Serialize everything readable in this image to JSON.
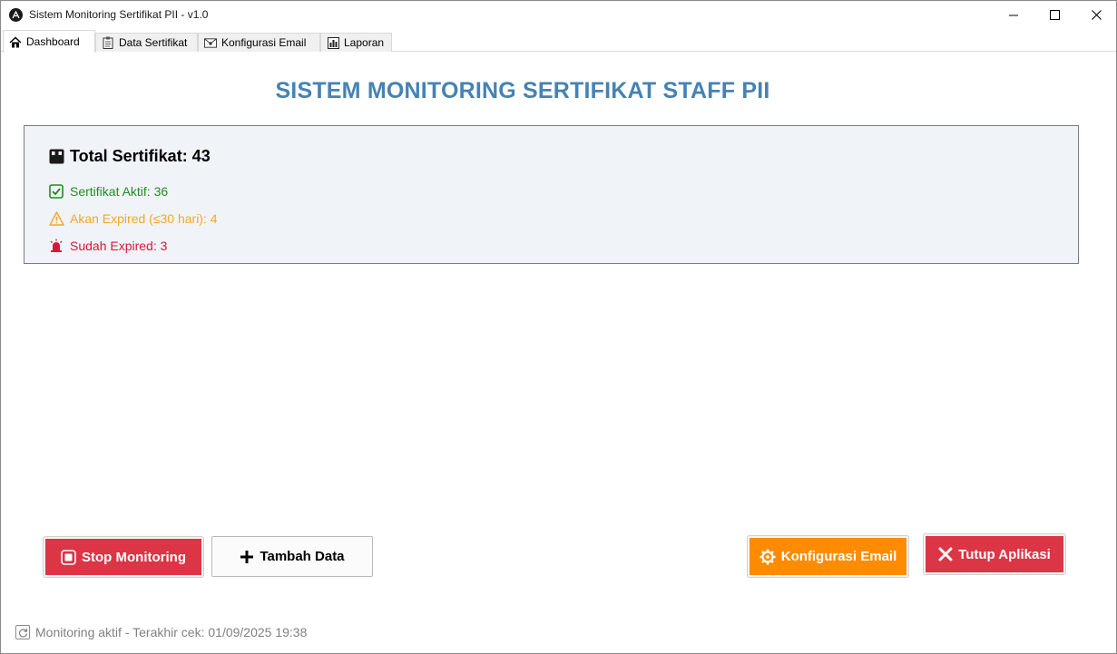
{
  "window": {
    "title": "Sistem Monitoring Sertifikat PII - v1.0"
  },
  "tabs": [
    {
      "label": "Dashboard",
      "icon": "home-icon"
    },
    {
      "label": "Data Sertifikat",
      "icon": "clipboard-icon"
    },
    {
      "label": "Konfigurasi Email",
      "icon": "mail-icon"
    },
    {
      "label": "Laporan",
      "icon": "bar-chart-icon"
    }
  ],
  "header": {
    "title": "SISTEM MONITORING SERTIFIKAT STAFF PII"
  },
  "stats": {
    "total": "Total Sertifikat: 43",
    "active": "Sertifikat Aktif: 36",
    "expiring": "Akan Expired (≤30 hari): 4",
    "expired": "Sudah Expired: 3"
  },
  "buttons": {
    "stop": "Stop Monitoring",
    "add": "Tambah Data",
    "email": "Konfigurasi Email",
    "exit": "Tutup Aplikasi"
  },
  "status": {
    "text": "Monitoring aktif - Terakhir cek: 01/09/2025 19:38"
  },
  "colors": {
    "title": "#4682b4",
    "active": "#228b22",
    "expiring": "#f5a623",
    "expired": "#dc143c",
    "stop_button": "#dc3545",
    "email_button": "#ff8c00",
    "exit_button": "#dc3545"
  }
}
